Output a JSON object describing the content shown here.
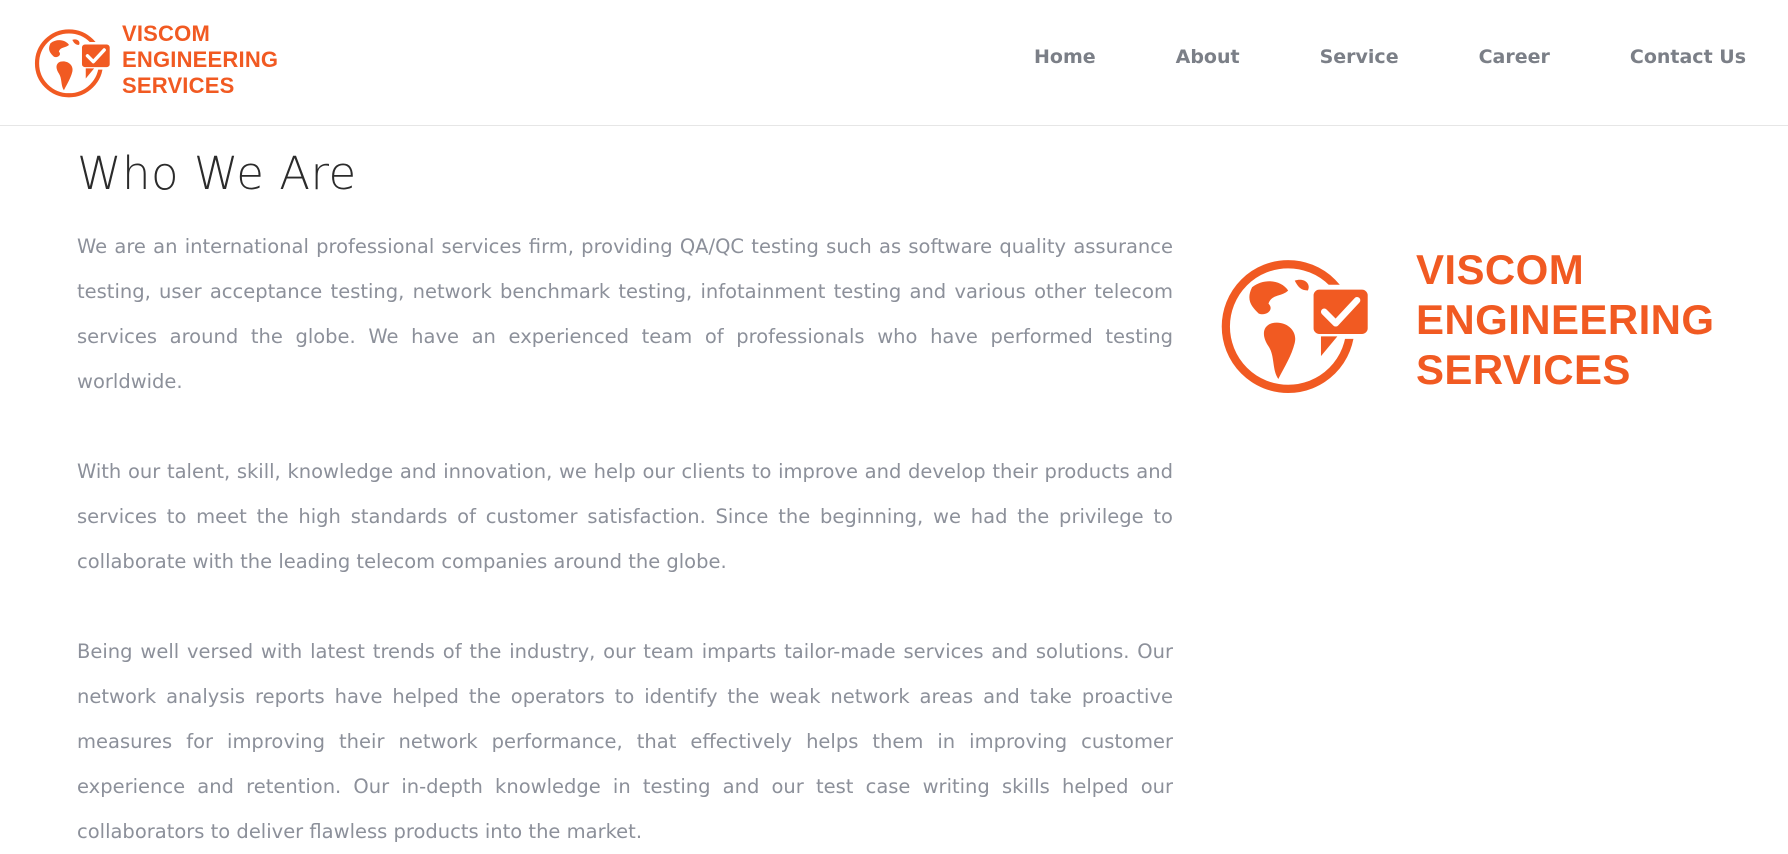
{
  "brand": {
    "name_line1": "VISCOM",
    "name_line2": "ENGINEERING",
    "name_line3": "SERVICES",
    "color": "#f15a22",
    "icon": "globe-check-chat-icon"
  },
  "nav": {
    "items": [
      {
        "label": "Home"
      },
      {
        "label": "About"
      },
      {
        "label": "Service"
      },
      {
        "label": "Career"
      },
      {
        "label": "Contact Us"
      }
    ]
  },
  "main": {
    "title": "Who We Are",
    "paragraphs": [
      "We are an international professional services firm, providing QA/QC testing such as software quality assurance testing, user acceptance testing, network benchmark testing, infotainment testing and various other telecom services around the globe. We have an experienced team of professionals who have performed testing worldwide.",
      "With our talent, skill, knowledge and innovation, we help our clients to improve and develop their products and services to meet the high standards of customer satisfaction. Since the beginning, we had the privilege to collaborate with the leading telecom companies around the globe.",
      "Being well versed with latest trends of the industry, our team imparts tailor-made services and solutions. Our network analysis reports have helped the operators to identify the weak network areas and take proactive measures for improving their network performance, that effectively helps them in improving customer experience and retention. Our in-depth knowledge in testing and our test case writing skills helped our collaborators to deliver flawless products into the market."
    ]
  }
}
